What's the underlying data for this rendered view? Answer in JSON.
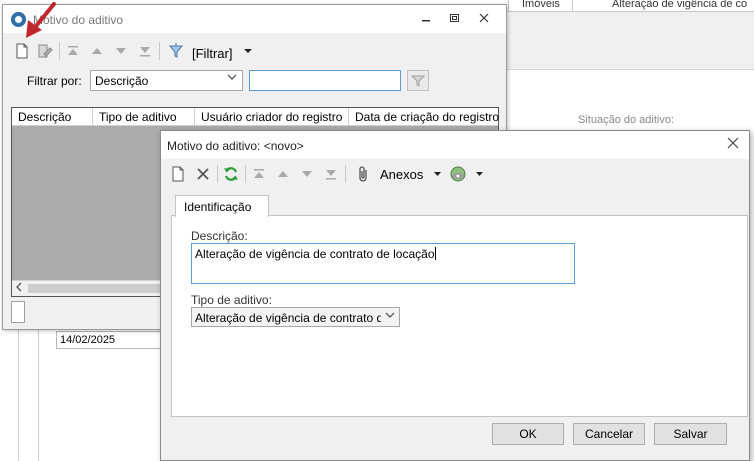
{
  "background": {
    "tabs": [
      "Imóveis",
      "Alteração de vigência de co"
    ],
    "situacao_label": "Situação do aditivo:",
    "date_value": "14/02/2025"
  },
  "window1": {
    "title": "Motivo do aditivo",
    "filter_button_label": "[Filtrar]",
    "filter_by_label": "Filtrar por:",
    "filter_field_value": "Descrição",
    "filter_text_value": "",
    "columns": [
      "Descrição",
      "Tipo de aditivo",
      "Usuário criador do registro",
      "Data de criação do registro"
    ]
  },
  "dialog": {
    "title": "Motivo do aditivo: <novo>",
    "attachments_label": "Anexos",
    "tab_label": "Identificação",
    "description_label": "Descrição:",
    "description_value": "Alteração de vigência de contrato de locação",
    "type_label": "Tipo de aditivo:",
    "type_value": "Alteração de vigência de contrato de lo",
    "ok_label": "OK",
    "cancel_label": "Cancelar",
    "save_label": "Salvar"
  },
  "colors": {
    "accent_border": "#5b9bd5",
    "annotation_arrow": "#c0272d",
    "refresh_icon": "#2e9d3a"
  }
}
